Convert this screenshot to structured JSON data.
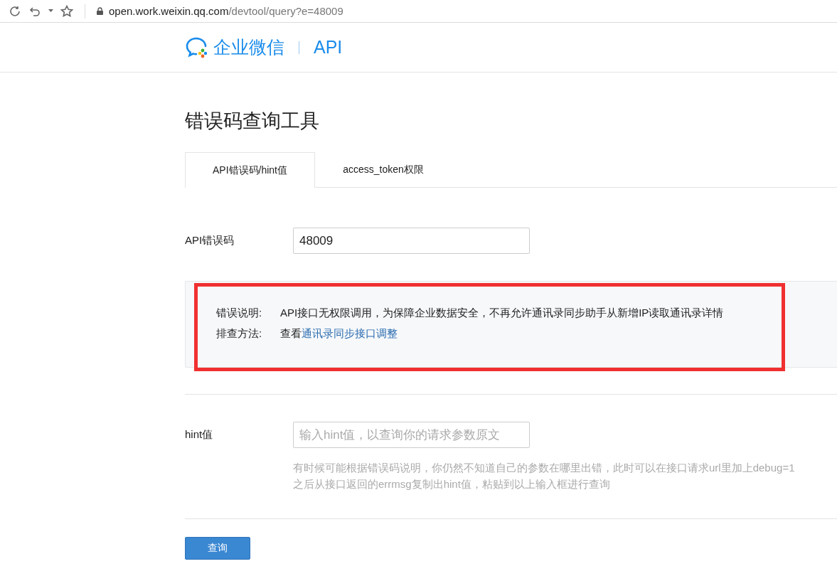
{
  "browser": {
    "url_host": "open.work.weixin.qq.com",
    "url_path": "/devtool/query?e=48009"
  },
  "header": {
    "brand": "企业微信",
    "product": "API"
  },
  "title": "错误码查询工具",
  "tabs": [
    {
      "label": "API错误码/hint值",
      "selected": true
    },
    {
      "label": "access_token权限",
      "selected": false
    }
  ],
  "error_code": {
    "label": "API错误码",
    "value": "48009"
  },
  "result": {
    "rows": [
      {
        "label": "错误说明:",
        "text": "API接口无权限调用，为保障企业数据安全，不再允许通讯录同步助手从新增IP读取通讯录详情"
      },
      {
        "label": "排查方法:",
        "text": "查看",
        "link": "通讯录同步接口调整"
      }
    ]
  },
  "hint": {
    "label": "hint值",
    "placeholder": "输入hint值，以查询你的请求参数原文",
    "help": [
      "有时候可能根据错误码说明，你仍然不知道自己的参数在哪里出错，此时可以在接口请求url里加上debug=1",
      "之后从接口返回的errmsg复制出hint值，粘贴到以上输入框进行查询"
    ]
  },
  "button": "查询"
}
